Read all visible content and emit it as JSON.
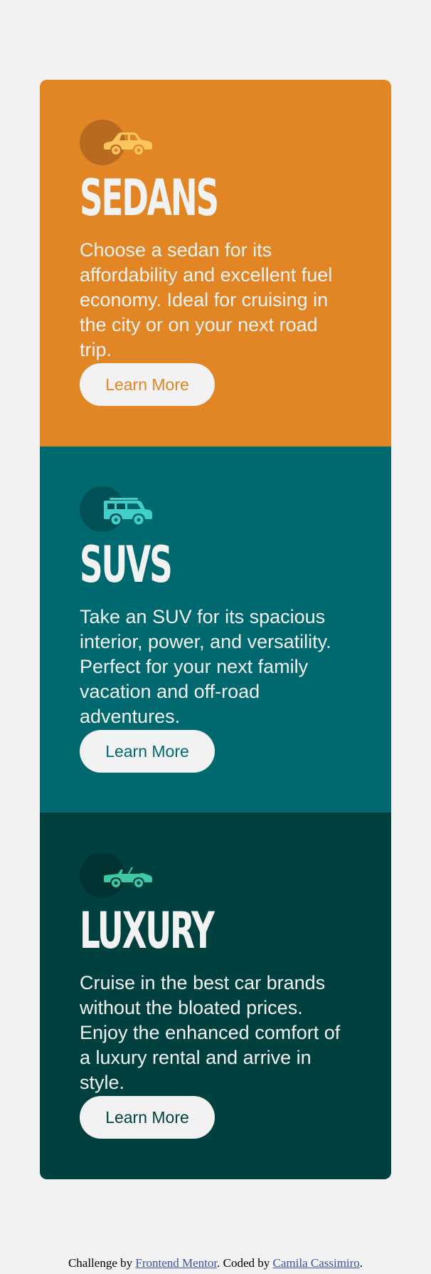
{
  "colors": {
    "page_bg": "#f2f2f2",
    "sedans": "#e28625",
    "suvs": "#006970",
    "luxury": "#004140",
    "sedans_icon": "#fdc55e",
    "suvs_icon": "#43cfc9",
    "luxury_icon": "#3ec9a4"
  },
  "cards": [
    {
      "icon": "sedan-car-icon",
      "title": "SEDANS",
      "description": "Choose a sedan for its affordability and excellent fuel economy. Ideal for cruising in the city or on your next road trip.",
      "button_label": "Learn More"
    },
    {
      "icon": "suv-car-icon",
      "title": "SUVS",
      "description": "Take an SUV for its spacious interior, power, and versatility. Perfect for your next family vacation and off-road adventures.",
      "button_label": "Learn More"
    },
    {
      "icon": "luxury-car-icon",
      "title": "LUXURY",
      "description": "Cruise in the best car brands without the bloated prices. Enjoy the enhanced comfort of a luxury rental and arrive in style.",
      "button_label": "Learn More"
    }
  ],
  "attribution": {
    "prefix": "Challenge by ",
    "link1": "Frontend Mentor",
    "middle": ". Coded by ",
    "link2": "Camila Cassimiro",
    "suffix": "."
  }
}
